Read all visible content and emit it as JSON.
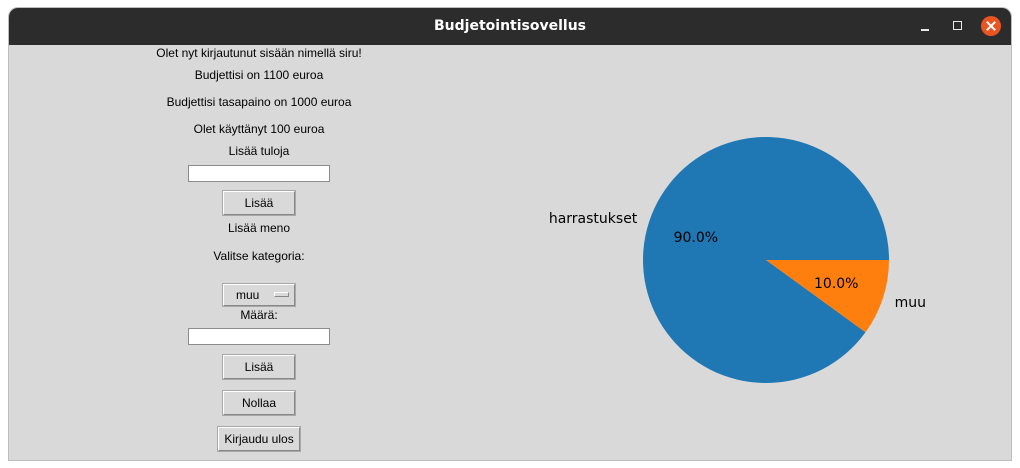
{
  "window": {
    "title": "Budjetointisovellus"
  },
  "main": {
    "logged_in_text": "Olet nyt kirjautunut sisään nimellä siru!",
    "budget_text": "Budjettisi on 1100 euroa",
    "balance_text": "Budjettisi tasapaino on 1000 euroa",
    "spent_text": "Olet käyttänyt 100 euroa",
    "add_income_label": "Lisää tuloja",
    "income_value": "",
    "add_income_button": "Lisää",
    "add_expense_label": "Lisää meno",
    "category_label": "Valitse kategoria:",
    "category_selected": "muu",
    "amount_label": "Määrä:",
    "amount_value": "",
    "add_expense_button": "Lisää",
    "reset_button": "Nollaa",
    "logout_button": "Kirjaudu ulos"
  },
  "chart_data": {
    "type": "pie",
    "categories": [
      "harrastukset",
      "muu"
    ],
    "values": [
      90.0,
      10.0
    ],
    "value_labels": [
      "90.0%",
      "10.0%"
    ],
    "colors": [
      "#1f77b4",
      "#ff7f0e"
    ],
    "title": ""
  }
}
